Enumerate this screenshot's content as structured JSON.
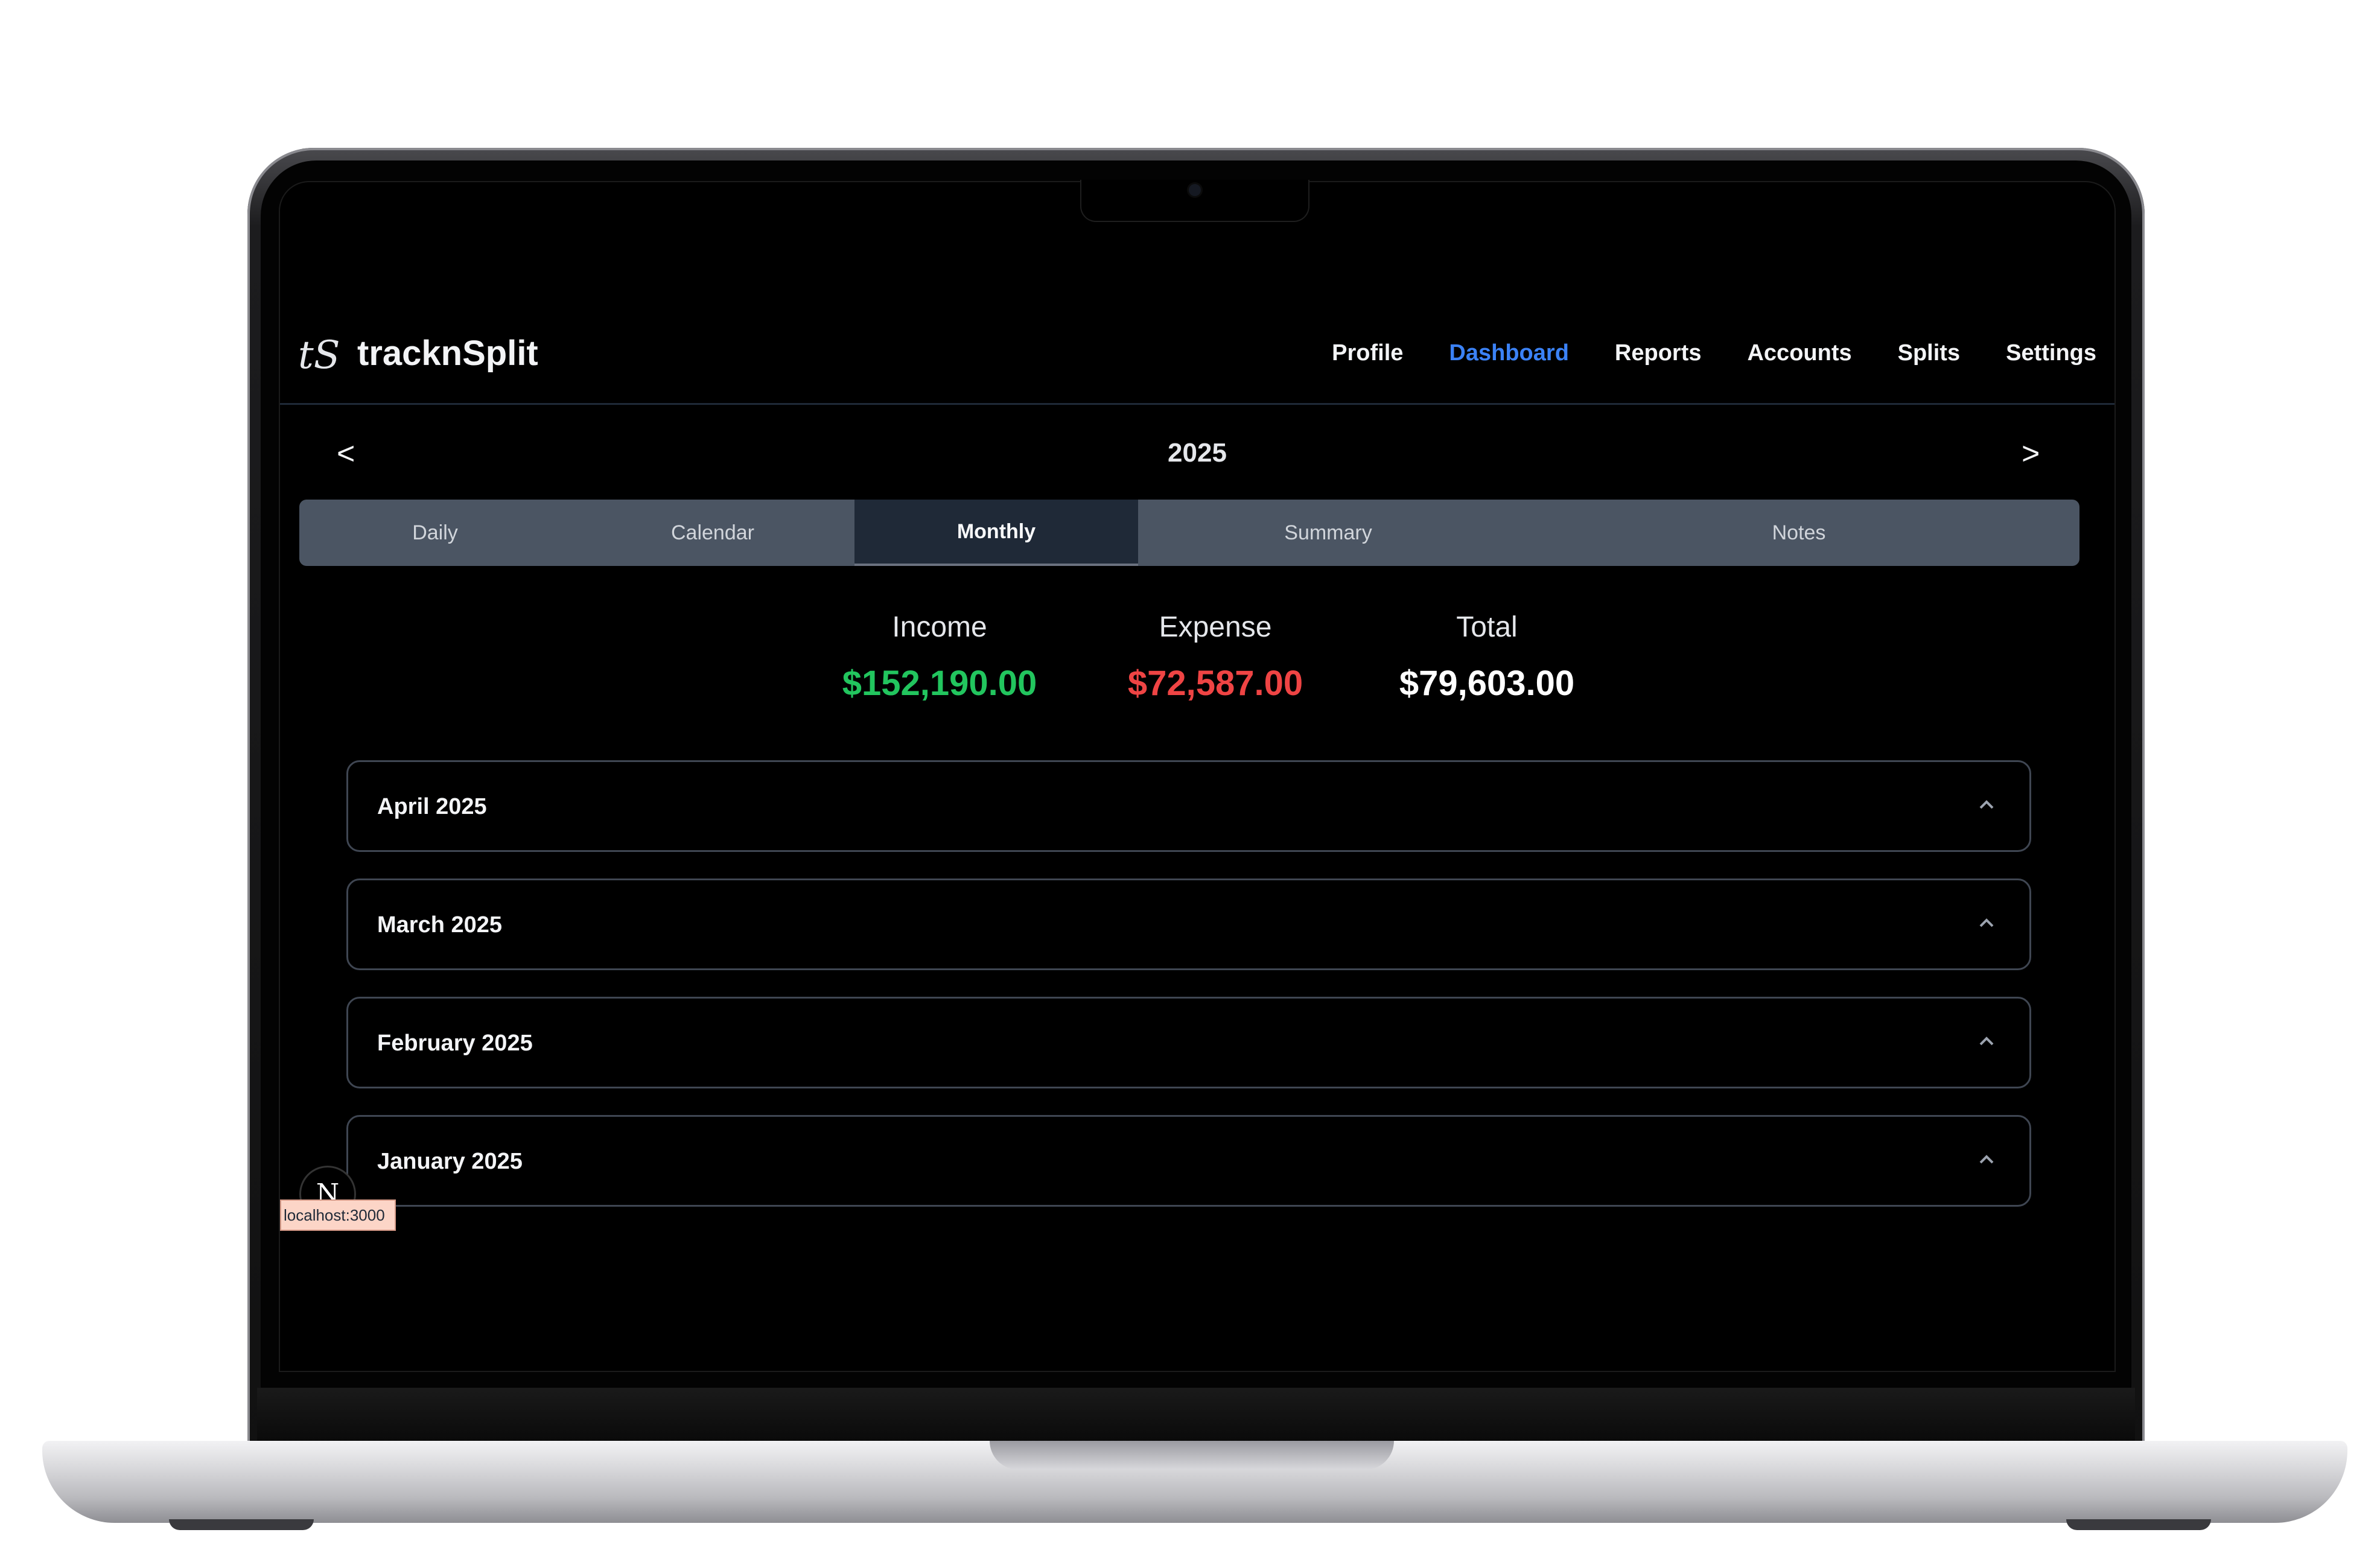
{
  "app": {
    "logo_mark": "tS",
    "name": "tracknSplit"
  },
  "nav": [
    {
      "label": "Profile",
      "active": false
    },
    {
      "label": "Dashboard",
      "active": true
    },
    {
      "label": "Reports",
      "active": false
    },
    {
      "label": "Accounts",
      "active": false
    },
    {
      "label": "Splits",
      "active": false
    },
    {
      "label": "Settings",
      "active": false
    }
  ],
  "year_nav": {
    "prev": "<",
    "year": "2025",
    "next": ">"
  },
  "tabs": [
    {
      "label": "Daily",
      "active": false
    },
    {
      "label": "Calendar",
      "active": false
    },
    {
      "label": "Monthly",
      "active": true
    },
    {
      "label": "Summary",
      "active": false
    },
    {
      "label": "Notes",
      "active": false
    }
  ],
  "summary": {
    "income_label": "Income",
    "income_value": "$152,190.00",
    "expense_label": "Expense",
    "expense_value": "$72,587.00",
    "total_label": "Total",
    "total_value": "$79,603.00"
  },
  "months": [
    {
      "label": "April 2025",
      "icon": "chevron-up-icon"
    },
    {
      "label": "March 2025",
      "icon": "chevron-up-icon"
    },
    {
      "label": "February 2025",
      "icon": "chevron-up-icon"
    },
    {
      "label": "January 2025",
      "icon": "chevron-up-icon"
    }
  ],
  "dev_indicator": {
    "badge": "N",
    "tooltip": "localhost:3000"
  },
  "colors": {
    "accent": "#3b82f6",
    "income": "#22c55e",
    "expense": "#ef4444",
    "tab_bar": "#4b5563",
    "tab_active": "#1f2937"
  }
}
